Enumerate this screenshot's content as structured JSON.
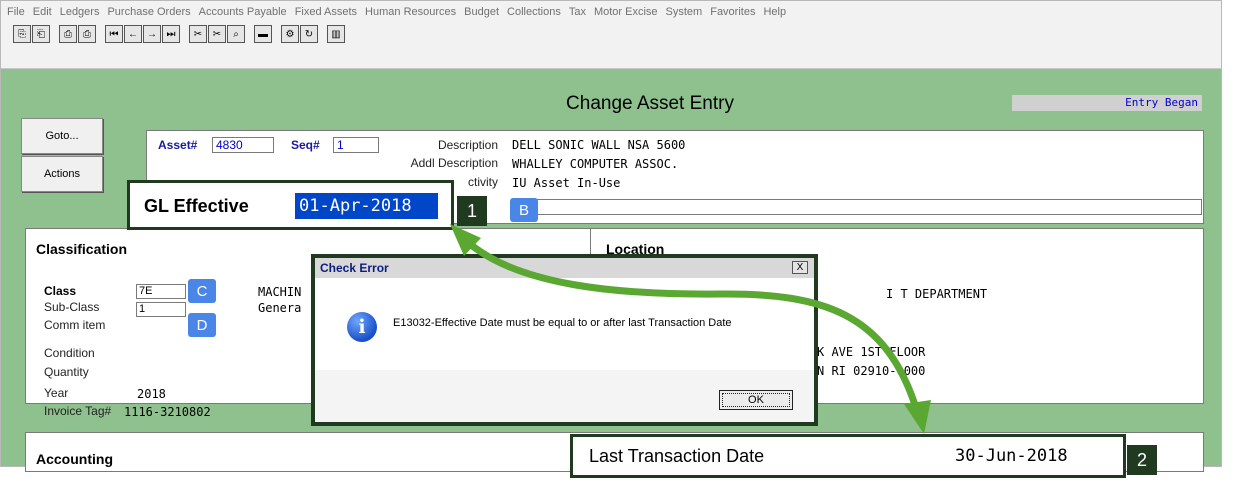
{
  "menu": [
    "File",
    "Edit",
    "Ledgers",
    "Purchase Orders",
    "Accounts Payable",
    "Fixed Assets",
    "Human Resources",
    "Budget",
    "Collections",
    "Tax",
    "Motor Excise",
    "System",
    "Favorites",
    "Help"
  ],
  "toolbar": {
    "icons": [
      "copy-icon",
      "paste-icon",
      "print-icon",
      "print-setup-icon",
      "first-record-icon",
      "previous-record-icon",
      "next-record-icon",
      "last-record-icon",
      "tools-icon",
      "tools-alt-icon",
      "search-icon",
      "screen-icon",
      "properties-icon",
      "refresh-icon",
      "chart-icon"
    ],
    "glyphs": [
      "⎘",
      "⎗",
      "⎙",
      "⎙",
      "⏮",
      "←",
      "→",
      "⏭",
      "✂",
      "✂",
      "⌕",
      "▬",
      "⚙",
      "↻",
      "▥"
    ]
  },
  "screen": {
    "title": "Change Asset Entry",
    "entry_status": "Entry Began"
  },
  "side_buttons": {
    "goto": "Goto...",
    "actions": "Actions"
  },
  "header": {
    "asset_label": "Asset#",
    "asset_value": "4830",
    "seq_label": "Seq#",
    "seq_value": "1",
    "description_label": "Description",
    "description_value": "DELL SONIC WALL NSA 5600",
    "addl_description_label": "Addl Description",
    "addl_description_value": "WHALLEY COMPUTER ASSOC.",
    "activity_label": "ctivity",
    "activity_value": "IU Asset In-Use"
  },
  "gl_effective": {
    "label": "GL Effective",
    "value": "01-Apr-2018"
  },
  "classification": {
    "title": "Classification",
    "class_label": "Class",
    "class_value": "7E",
    "class_desc": "MACHIN",
    "subclass_label": "Sub-Class",
    "subclass_value": "1",
    "subclass_desc": "Genera",
    "comm_item_label": "Comm item",
    "condition_label": "Condition",
    "quantity_label": "Quantity",
    "year_label": "Year",
    "year_value": "2018",
    "invoice_tag_label": "Invoice Tag#",
    "invoice_tag_value": "1116-3210802"
  },
  "location": {
    "title": "Location",
    "department": "I T DEPARTMENT",
    "address_line": "K AVE  1ST FLOOR",
    "city_line": "N RI 02910-0000"
  },
  "accounting": {
    "title": "Accounting"
  },
  "dialog": {
    "title": "Check Error",
    "close_glyph": "X",
    "message": "E13032-Effective Date must be equal to or after last Transaction Date",
    "ok": "OK"
  },
  "last_transaction": {
    "label": "Last Transaction Date",
    "value": "30-Jun-2018"
  },
  "annotations": {
    "badge1": "1",
    "badge2": "2",
    "letter_b": "B",
    "letter_c": "C",
    "letter_d": "D"
  },
  "colors": {
    "frame_green": "#8fc18f",
    "callout_dark": "#1f3a1f",
    "arrow_green": "#5aa832",
    "badge_blue": "#4a86e8",
    "highlight_blue": "#0046c8"
  }
}
